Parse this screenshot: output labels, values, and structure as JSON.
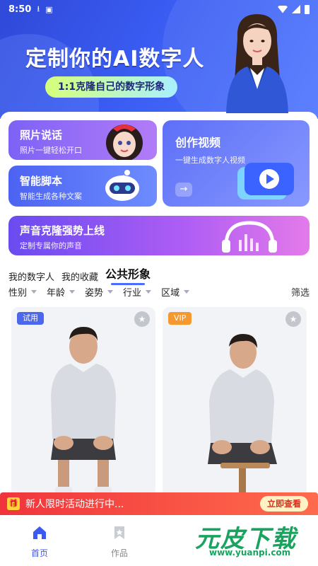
{
  "status_bar": {
    "time": "8:50"
  },
  "hero": {
    "title": "定制你的AI数字人",
    "badge": "1:1克隆自己的数字形象"
  },
  "features": {
    "photo_talk": {
      "title": "照片说话",
      "subtitle": "照片一键轻松开口"
    },
    "smart_script": {
      "title": "智能脚本",
      "subtitle": "智能生成各种文案"
    },
    "create_video": {
      "title": "创作视频",
      "subtitle": "一键生成数字人视频",
      "arrow": "→"
    },
    "voice_clone": {
      "title": "声音克隆强势上线",
      "subtitle": "定制专属你的声音"
    }
  },
  "tabs": [
    {
      "label": "我的数字人"
    },
    {
      "label": "我的收藏"
    },
    {
      "label": "公共形象",
      "active": true
    }
  ],
  "filters": [
    "性别",
    "年龄",
    "姿势",
    "行业",
    "区域"
  ],
  "filter_button": "筛选",
  "avatars": [
    {
      "tag": "试用",
      "tag_color": "#4b67ee",
      "favorite_icon": "star-icon"
    },
    {
      "tag": "VIP",
      "tag_color": "#f5982f",
      "favorite_icon": "star-icon"
    }
  ],
  "promo": {
    "text": "新人限时活动进行中...",
    "button": "立即查看",
    "icon": "gift-icon"
  },
  "nav": [
    {
      "label": "首页",
      "icon": "home-icon",
      "active": true,
      "color": "#3b5bf0"
    },
    {
      "label": "作品",
      "icon": "bookmark-icon"
    }
  ],
  "watermark": {
    "brand": "元皮下载",
    "url": "www.yuanpi.com"
  }
}
